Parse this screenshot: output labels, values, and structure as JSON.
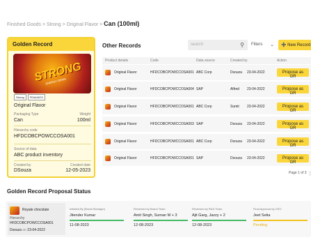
{
  "breadcrumb": {
    "part1": "Finished Goods",
    "sep1": ">",
    "part2": "Strong",
    "sep2": ">",
    "part3": "Original Flavor",
    "sep3": ">",
    "current": "Can (100ml)"
  },
  "golden": {
    "title": "Golden Record",
    "can_brand": "STRONG",
    "can_tagline": "ENERGY DRINK",
    "tags": [
      "Strong",
      "FE#A4023"
    ],
    "name": "Original Flavor",
    "packaging_type_label": "Packaging Type",
    "packaging_type": "Can",
    "weight_label": "Weight",
    "weight": "100ml",
    "hierarchy_label": "Hierarchy code",
    "hierarchy": "HFDCOBCPOWCCOSA001",
    "source_label": "Source of data",
    "source": "ABC product inventory",
    "created_by_label": "Created by",
    "created_by": "DSouza",
    "created_date_label": "Created date",
    "created_date": "12-05-2023"
  },
  "other": {
    "title": "Other Records",
    "search_placeholder": "search",
    "filters_label": "Filters",
    "new_button": "New Record",
    "columns": [
      "Product details",
      "Code",
      "Data source",
      "Created by",
      "Action"
    ],
    "rows": [
      {
        "product": "Original Flavor",
        "code": "HFDCOBCPOWCCOSA001",
        "source": "ABC Corp",
        "user": "Dsouza",
        "date": "23-04-2022",
        "action": "Propose as GR"
      },
      {
        "product": "Original Flavor",
        "code": "HFDCOBCPOWCCOSA004",
        "source": "SAP",
        "user": "Alfred",
        "date": "23-04-2022",
        "action": "Propose as GR"
      },
      {
        "product": "Original Flavor",
        "code": "HFDCOBCPOWCCOSA001",
        "source": "ABC Corp",
        "user": "Sumit",
        "date": "23-04-2022",
        "action": "Propose as GR"
      },
      {
        "product": "Original Flavor",
        "code": "HFDCOBCPOWCCOSA003",
        "source": "SAP",
        "user": "Dsouza",
        "date": "23-04-2022",
        "action": "Propose as GR"
      },
      {
        "product": "Original Flavor",
        "code": "HFDCOBCPOWCCOSA001",
        "source": "ABC Corp",
        "user": "Dsouza",
        "date": "23-04-2022",
        "action": "Propose as GR"
      },
      {
        "product": "Original Flavor",
        "code": "HFDCOBCPOWCCOSA001",
        "source": "SAP",
        "user": "Dsouza",
        "date": "23-04-2022",
        "action": "Propose as GR"
      }
    ],
    "pager": "Page 1 of 3"
  },
  "proposal": {
    "title": "Golden Record Proposal Status",
    "card": {
      "name": "Royale chocolate",
      "hierarchy_label": "Hierarchy",
      "hierarchy": "HFDCOBCPOWCCOSA001",
      "user": "Dsouza",
      "on": "on",
      "date": "23-04-2022"
    },
    "stages": [
      {
        "label": "Initiated By (Brand Manager)",
        "name": "Jitender Kumar",
        "date": "11-08-2023",
        "color": "#43b866"
      },
      {
        "label": "Reviewed by Brand Team",
        "name": "Amit Singh, Suman M + 3",
        "date": "12-08-2023",
        "color": "#43b866"
      },
      {
        "label": "Reviewed by R&D Team",
        "name": "Ajit Garg, Jazzy + 2",
        "date": "12-08-2023",
        "color": "#43b866"
      },
      {
        "label": "Final Approval by CEO",
        "name": "Jeet Setia",
        "date": "Pending",
        "color": "#f2c31c"
      }
    ]
  }
}
